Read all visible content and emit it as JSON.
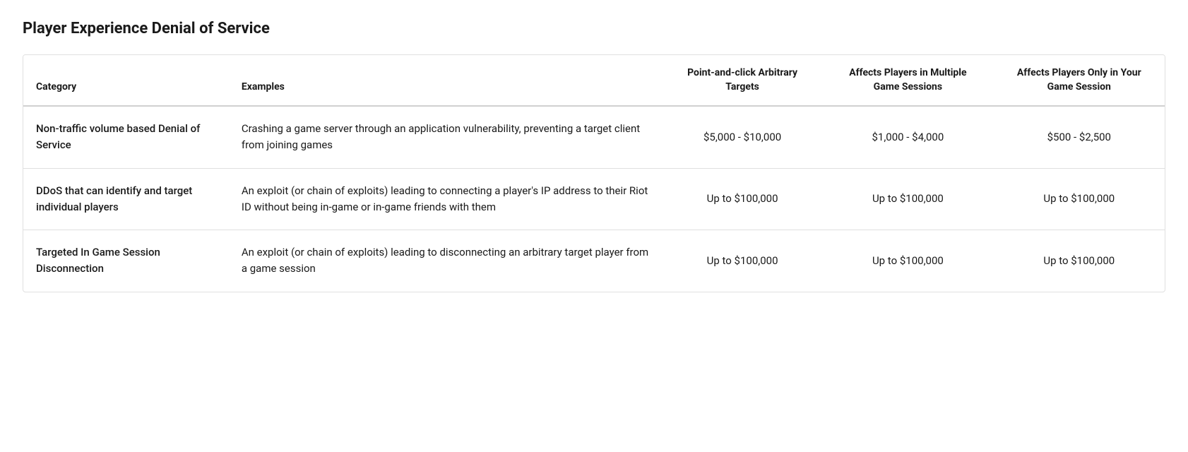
{
  "page": {
    "title": "Player Experience Denial of Service"
  },
  "table": {
    "headers": {
      "category": "Category",
      "examples": "Examples",
      "col1": "Point-and-click Arbitrary Targets",
      "col2": "Affects Players in Multiple Game Sessions",
      "col3": "Affects Players Only in Your Game Session"
    },
    "rows": [
      {
        "category": "Non-traffic volume based Denial of Service",
        "examples": "Crashing a game server through an application vulnerability, preventing a target client from joining games",
        "col1": "$5,000 - $10,000",
        "col2": "$1,000 - $4,000",
        "col3": "$500 - $2,500"
      },
      {
        "category": "DDoS that can identify and target individual players",
        "examples": "An exploit (or chain of exploits) leading to connecting a player's IP address to their Riot ID without being in-game or in-game friends with them",
        "col1": "Up to $100,000",
        "col2": "Up to $100,000",
        "col3": "Up to $100,000"
      },
      {
        "category": "Targeted In Game Session Disconnection",
        "examples": "An exploit (or chain of exploits) leading to disconnecting an arbitrary target player from a game session",
        "col1": "Up to $100,000",
        "col2": "Up to $100,000",
        "col3": "Up to $100,000"
      }
    ]
  }
}
